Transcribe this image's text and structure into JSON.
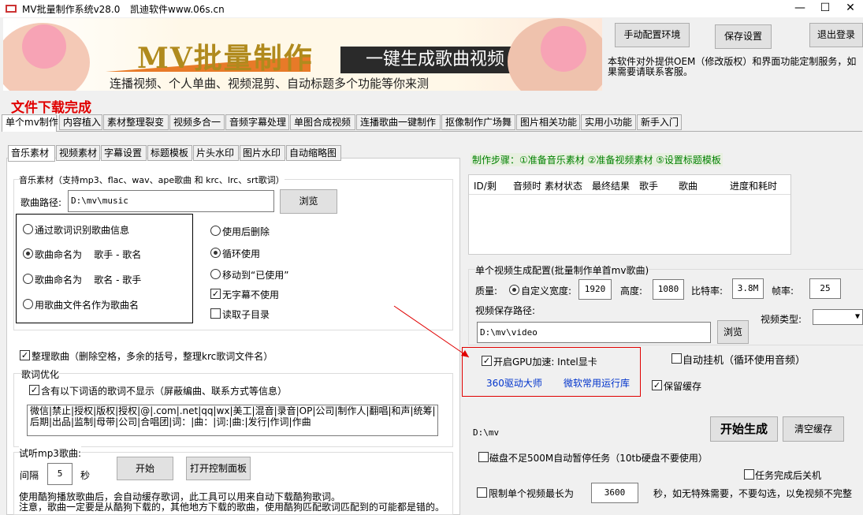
{
  "window": {
    "title": "MV批量制作系统v28.0",
    "vendor": "凯迪软件www.06s.cn",
    "minimize": "—",
    "maximize": "☐",
    "close": "✕"
  },
  "banner": {
    "title": "MV批量制作",
    "slogan": "一键生成歌曲视频",
    "subtitle": "连播视频、个人单曲、视频混剪、自动标题多个功能等你来测"
  },
  "top_buttons": {
    "manual_env": "手动配置环境",
    "save_settings": "保存设置",
    "logout": "退出登录"
  },
  "notice": "本软件对外提供OEM（修改版权）和界面功能定制服务，如果需要请联系客服。",
  "status": "文件下载完成",
  "main_tabs": [
    "单个mv制作",
    "内容植入",
    "素材整理裂变",
    "视频多合一",
    "音频字幕处理",
    "单图合成视频",
    "连播歌曲一键制作",
    "抠像制作广场舞",
    "图片相关功能",
    "实用小功能",
    "新手入门"
  ],
  "sub_tabs": [
    "音乐素材",
    "视频素材",
    "字幕设置",
    "标题模板",
    "片头水印",
    "图片水印",
    "自动缩略图"
  ],
  "music": {
    "group_title": "音乐素材（支持mp3、flac、wav、ape歌曲 和 krc、lrc、srt歌词）",
    "path_label": "歌曲路径:",
    "path_value": "D:\\mv\\music",
    "browse": "浏览",
    "naming": [
      {
        "label": "通过歌词识别歌曲信息",
        "checked": false
      },
      {
        "label": "歌曲命名为    歌手 - 歌名",
        "checked": true
      },
      {
        "label": "歌曲命名为    歌名 - 歌手",
        "checked": false
      },
      {
        "label": "用歌曲文件名作为歌曲名",
        "checked": false
      }
    ],
    "after_use": [
      {
        "label": "使用后删除",
        "checked": false
      },
      {
        "label": "循环使用",
        "checked": true
      },
      {
        "label": "移动到“已使用”",
        "checked": false
      }
    ],
    "no_subtitle": "无字幕不使用",
    "read_subdir": "读取子目录",
    "tidy_label": "整理歌曲（删除空格，多余的括号，整理krc歌词文件名）",
    "lyric_opt_title": "歌词优化",
    "lyric_hide_label": "含有以下词语的歌词不显示（屏蔽编曲、联系方式等信息）",
    "lyric_words": "微信|禁止|授权|版权|授权|@|.com|.net|qq|wx|美工|混音|录音|OP|公司|制作人|翻唱|和声|统筹|后期|出品|监制|母带|公司|合唱团|词：|曲：|词:|曲:|发行|作词|作曲"
  },
  "preview": {
    "title": "试听mp3歌曲:",
    "interval_label": "间隔",
    "interval_value": "5",
    "sec": "秒",
    "start": "开始",
    "open_panel": "打开控制面板",
    "note1": "使用酷狗播放歌曲后，会自动缓存歌词，此工具可以用来自动下载酷狗歌词。",
    "note2": "注意，歌曲一定要是从酷狗下载的，其他地方下载的歌曲，使用酷狗匹配歌词匹配到的可能都是错的。"
  },
  "steps": "制作步骤：①准备音乐素材 ②准备视频素材  ⑤设置标题模板",
  "task_columns": [
    "ID/剩",
    "音频时",
    "素材状态",
    "最终结果",
    "歌手",
    "歌曲",
    "进度和耗时"
  ],
  "config": {
    "group_title": "单个视频生成配置(批量制作单首mv歌曲)",
    "quality_label": "质量:",
    "custom_width_label": "自定义宽度:",
    "width": "1920",
    "height_label": "高度:",
    "height": "1080",
    "bitrate_label": "比特率:",
    "bitrate": "3.8M",
    "fps_label": "帧率:",
    "fps": "25",
    "save_path_label": "视频保存路径:",
    "save_path": "D:\\mv\\video",
    "browse": "浏览",
    "video_type_label": "视频类型:",
    "gpu_label": "开启GPU加速: Intel显卡",
    "link_360": "360驱动大师",
    "link_ms": "微软常用运行库",
    "auto_hang": "自动挂机（循环使用音频）",
    "keep_cache": "保留缓存",
    "out_dir": "D:\\mv",
    "start_gen": "开始生成",
    "clear_cache": "清空缓存",
    "disk_pause": "磁盘不足500M自动暂停任务（10tb硬盘不要使用）",
    "shutdown": "任务完成后关机",
    "limit_label": "限制单个视频最长为",
    "limit_value": "3600",
    "limit_tail": "秒，如无特殊需要，不要勾选，以免视频不完整"
  },
  "colors": {
    "accent_red": "#e00000",
    "link_blue": "#0033cc",
    "green": "#008000",
    "banner_gold": "#b08a1d"
  }
}
